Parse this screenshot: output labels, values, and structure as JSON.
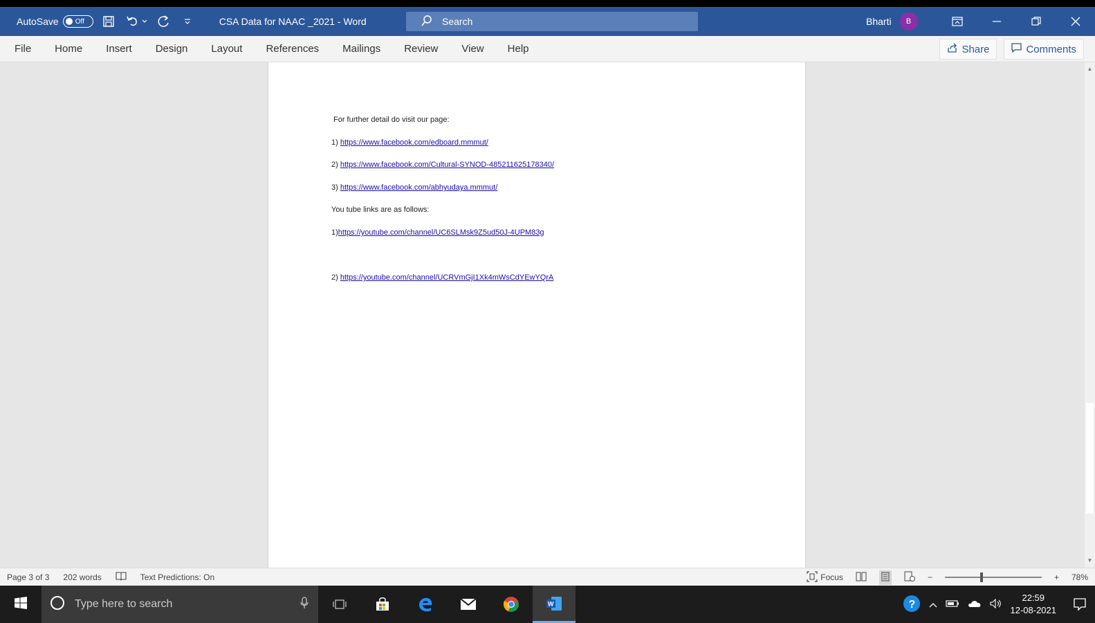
{
  "titlebar": {
    "autosave_label": "AutoSave",
    "autosave_state": "Off",
    "doc_title": "CSA Data for NAAC _2021  -  Word",
    "search_placeholder": "Search",
    "user_name": "Bharti",
    "user_initial": "B"
  },
  "ribbon": {
    "tabs": [
      "File",
      "Home",
      "Insert",
      "Design",
      "Layout",
      "References",
      "Mailings",
      "Review",
      "View",
      "Help"
    ],
    "share_label": "Share",
    "comments_label": "Comments"
  },
  "document": {
    "intro": "For further detail do visit our page:",
    "fb_links": [
      {
        "num": "1) ",
        "url": "https://www.facebook.com/edboard.mmmut/"
      },
      {
        "num": "2) ",
        "url": "https://www.facebook.com/Cultural-SYNOD-485211625178340/"
      },
      {
        "num": "3)  ",
        "url": "https://www.facebook.com/abhyudaya.mmmut/"
      }
    ],
    "yt_intro": "You tube links are as follows:",
    "yt_links": [
      {
        "num": "1)",
        "url": "https://youtube.com/channel/UC6SLMsk9Z5ud50J-4UPM83g"
      },
      {
        "num": "2) ",
        "url": "https://youtube.com/channel/UCRVmGjI1Xk4mWsCdYEwYQrA"
      }
    ]
  },
  "statusbar": {
    "page": "Page 3 of 3",
    "words": "202 words",
    "text_predictions": "Text Predictions: On",
    "focus": "Focus",
    "zoom_minus": "−",
    "zoom_plus": "+",
    "zoom": "78%",
    "zoom_level_percent": 78
  },
  "taskbar": {
    "search_placeholder": "Type here to search",
    "time": "22:59",
    "date": "12-08-2021"
  }
}
